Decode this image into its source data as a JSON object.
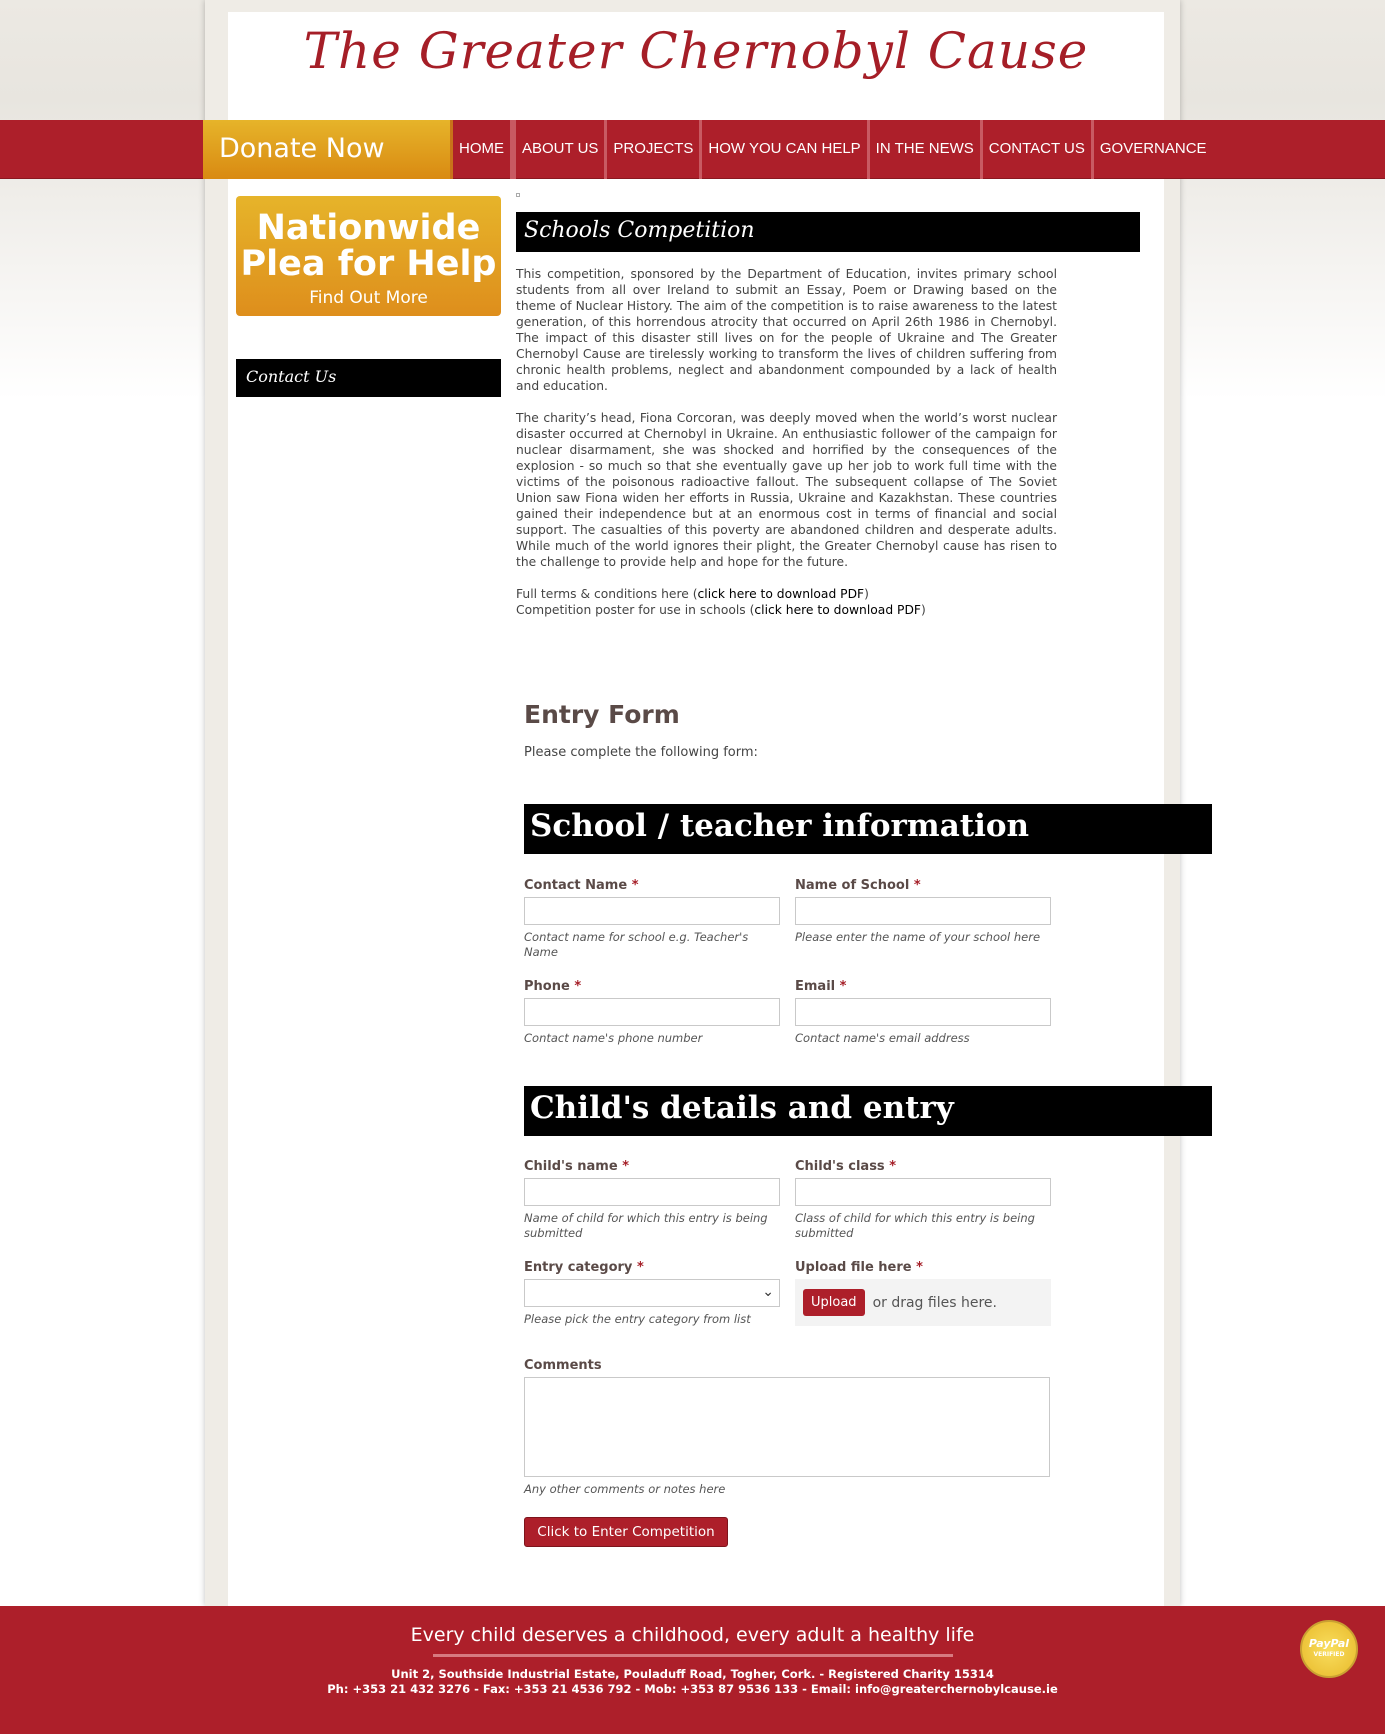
{
  "header": {
    "site_title": "The Greater Chernobyl Cause",
    "donate_label": "Donate Now"
  },
  "nav": {
    "items": [
      "HOME",
      "ABOUT US",
      "PROJECTS",
      "HOW YOU CAN HELP",
      "IN THE NEWS",
      "CONTACT US",
      "GOVERNANCE"
    ]
  },
  "sidebar": {
    "plea_title": "Nationwide Plea for Help",
    "plea_link": "Find Out More",
    "contact_heading": "Contact Us"
  },
  "article": {
    "heading": "Schools Competition",
    "para1": "This competition, sponsored by the Department of Education, invites primary school students from all over Ireland to submit an Essay, Poem or Drawing based on the theme of Nuclear History. The aim of the competition is to raise awareness to the latest generation, of this horrendous atrocity that occurred on April 26th 1986 in Chernobyl. The impact of this disaster still lives on for the people of Ukraine and The Greater Chernobyl Cause are tirelessly working to transform the lives of children suffering from chronic health problems, neglect and abandonment compounded by a lack of health and education.",
    "para2": "The charity’s head, Fiona Corcoran, was deeply moved when the world’s worst nuclear disaster occurred at Chernobyl in Ukraine. An enthusiastic follower of the campaign for nuclear disarmament, she was shocked and horrified by the consequences of the explosion - so much so that she eventually gave up her job to work full time with the victims of the poisonous radioactive fallout. The subsequent collapse of The Soviet Union saw Fiona widen her efforts in Russia, Ukraine and Kazakhstan. These countries gained their independence but at an enormous cost in terms of financial and social support. The casualties of this poverty are abandoned children and desperate adults. While much of the world ignores their plight, the Greater Chernobyl cause has risen to the challenge to provide help and hope for the future.",
    "terms_prefix": "Full terms & conditions here (",
    "terms_link": "click here to download PDF",
    "terms_suffix": ")",
    "poster_prefix": "Competition poster for use in schools (",
    "poster_link": "click here to download PDF",
    "poster_suffix": ")"
  },
  "form": {
    "title": "Entry Form",
    "subtitle": "Please complete the following form:",
    "section1": "School / teacher information",
    "section2": "Child's details and entry",
    "fields": {
      "contact_name": {
        "label": "Contact Name",
        "req": "*",
        "help": "Contact name for school e.g. Teacher's Name",
        "value": ""
      },
      "school_name": {
        "label": "Name of School",
        "req": "*",
        "help": "Please enter the name of your school here",
        "value": ""
      },
      "phone": {
        "label": "Phone",
        "req": "*",
        "help": "Contact name's phone number",
        "value": ""
      },
      "email": {
        "label": "Email",
        "req": "*",
        "help": "Contact name's email address",
        "value": ""
      },
      "child_name": {
        "label": "Child's name",
        "req": "*",
        "help": "Name of child for which this entry is being submitted",
        "value": ""
      },
      "child_class": {
        "label": "Child's class",
        "req": "*",
        "help": "Class of child for which this entry is being submitted",
        "value": ""
      },
      "category": {
        "label": "Entry category",
        "req": "*",
        "help": "Please pick the entry category from list",
        "value": ""
      },
      "upload": {
        "label": "Upload file here",
        "req": "*",
        "button": "Upload",
        "drag_text": "or drag files here."
      },
      "comments": {
        "label": "Comments",
        "help": "Any other comments or notes here",
        "value": ""
      }
    },
    "submit_label": "Click to Enter Competition"
  },
  "footer": {
    "tagline": "Every child deserves a childhood, every adult a healthy life",
    "address": "Unit 2, Southside Industrial Estate, Pouladuff Road, Togher, Cork. - Registered Charity 15314",
    "contacts": "Ph: +353 21 432 3276 - Fax: +353 21 4536 792 - Mob: +353 87 9536 133 - Email: info@greaterchernobylcause.ie",
    "badge_main": "PayPal",
    "badge_sub": "VERIFIED"
  },
  "colors": {
    "brand_red": "#ad1f2a",
    "donate_orange": "#e6b42a",
    "heading_black": "#000000"
  }
}
